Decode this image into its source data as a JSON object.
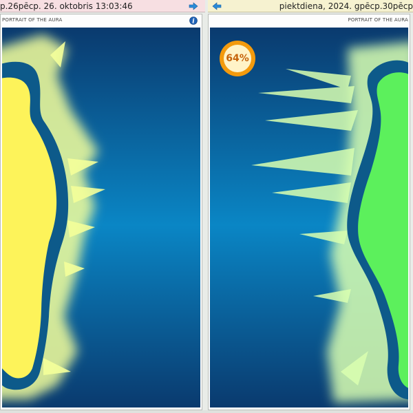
{
  "left_panel": {
    "header_text": "p.26pēcp. 26. oktobris 13:03:46",
    "title": "PORTRAIT OF THE AURA",
    "figure_color": "#fdf35a",
    "glow_color": "#f4ff9a"
  },
  "right_panel": {
    "header_text": "piektdiena, 2024. gpēcp.30pēcp",
    "title": "PORTRAIT OF THE AURA",
    "figure_color": "#5cf05c",
    "glow_color": "#d9ffb0",
    "percent": {
      "label": "64%",
      "value": 0.64,
      "color": "#f39a0d"
    }
  },
  "icons": {
    "forward": "arrow-right-icon",
    "back": "arrow-left-icon",
    "info": "info-icon"
  },
  "colors": {
    "background_top": "#0a3a6e",
    "background_mid": "#0a86c5",
    "outline": "#0d5a8a"
  }
}
